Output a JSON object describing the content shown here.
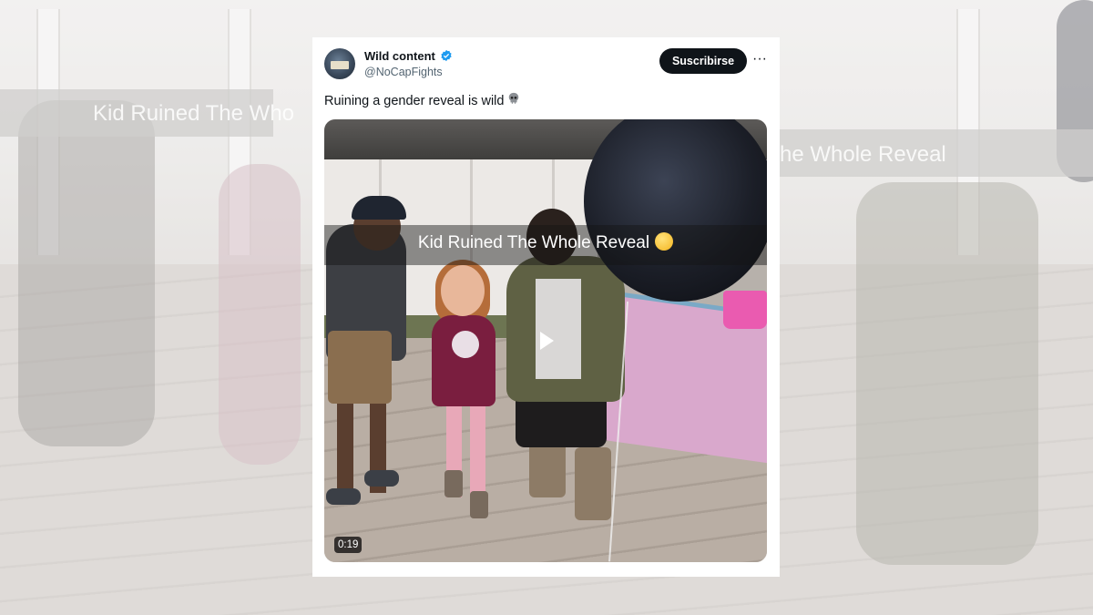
{
  "background": {
    "caption_left": "Kid Ruined The Who",
    "caption_right": "he Whole Reveal"
  },
  "tweet": {
    "author_name": "Wild content",
    "author_handle": "@NoCapFights",
    "verified_icon": "verified-badge-icon",
    "subscribe_label": "Suscribirse",
    "more_label": "···",
    "text": "Ruining a gender reveal is wild",
    "text_emoji": "skull-emoji",
    "video": {
      "caption": "Kid Ruined The Whole Reveal",
      "caption_emoji": "woozy-face-emoji",
      "duration": "0:19",
      "play_icon": "play-icon"
    }
  },
  "colors": {
    "verified_blue": "#1d9bf0",
    "button_black": "#0f1419",
    "handle_gray": "#536471"
  }
}
